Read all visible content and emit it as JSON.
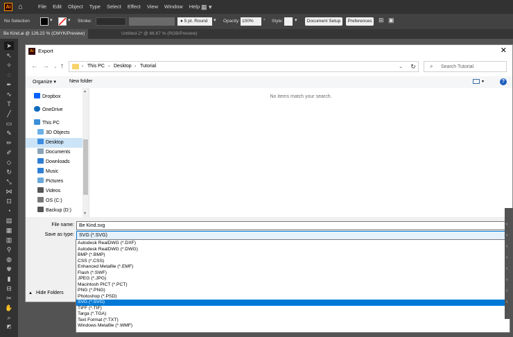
{
  "app": {
    "logo": "Ai",
    "menus": [
      "File",
      "Edit",
      "Object",
      "Type",
      "Select",
      "Effect",
      "View",
      "Window",
      "Help"
    ]
  },
  "optbar": {
    "selection": "No Selection",
    "stroke_label": "Stroke:",
    "brush": "5 pt. Round",
    "opacity_label": "Opacity:",
    "opacity_value": "100%",
    "style_label": "Style:",
    "doc_setup": "Document Setup",
    "preferences": "Preferences"
  },
  "tabs": [
    {
      "label": "Be Kind.ai @ 126.22 % (CMYK/Preview)",
      "active": true
    },
    {
      "label": "Untitled-2* @ 66.67 % (RGB/Preview)",
      "active": false
    }
  ],
  "dialog": {
    "title": "Export",
    "breadcrumb": [
      "This PC",
      "Desktop",
      "Tutorial"
    ],
    "search_placeholder": "Search Tutorial",
    "organize": "Organize",
    "new_folder": "New folder",
    "help": "?",
    "empty_message": "No items match your search.",
    "nav_items": [
      {
        "label": "Dropbox",
        "icon": "dropbox-icon",
        "color": "#0061fe"
      },
      {
        "label": "OneDrive",
        "icon": "cloud-icon",
        "color": "#0f6cbd"
      },
      {
        "label": "This PC",
        "icon": "computer-icon",
        "color": "#3a8fd8"
      },
      {
        "label": "3D Objects",
        "icon": "cube-icon",
        "color": "#6bb1e6"
      },
      {
        "label": "Desktop",
        "icon": "desktop-icon",
        "color": "#3d8ee0",
        "selected": true
      },
      {
        "label": "Documents",
        "icon": "document-icon",
        "color": "#8aa3b8"
      },
      {
        "label": "Downloads",
        "icon": "download-icon",
        "color": "#2f7fd4"
      },
      {
        "label": "Music",
        "icon": "music-icon",
        "color": "#2f7fd4"
      },
      {
        "label": "Pictures",
        "icon": "picture-icon",
        "color": "#6aa7d9"
      },
      {
        "label": "Videos",
        "icon": "video-icon",
        "color": "#555555"
      },
      {
        "label": "OS (C:)",
        "icon": "drive-icon",
        "color": "#777777"
      },
      {
        "label": "Backup (D:)",
        "icon": "drive-icon",
        "color": "#555555"
      }
    ],
    "file_name_label": "File name:",
    "file_name_value": "Be Kind.svg",
    "save_type_label": "Save as type:",
    "save_type_value": "SVG (*.SVG)",
    "hide_folders": "Hide Folders",
    "type_options": [
      "Autodesk RealDWG (*.DXF)",
      "Autodesk RealDWG (*.DWG)",
      "BMP (*.BMP)",
      "CSS (*.CSS)",
      "Enhanced Metafile (*.EMF)",
      "Flash (*.SWF)",
      "JPEG (*.JPG)",
      "Macintosh PICT (*.PCT)",
      "PNG (*.PNG)",
      "Photoshop (*.PSD)",
      "SVG (*.SVG)",
      "TIFF (*.TIF)",
      "Targa (*.TGA)",
      "Text Format (*.TXT)",
      "Windows Metafile (*.WMF)"
    ],
    "selected_type_index": 10
  }
}
